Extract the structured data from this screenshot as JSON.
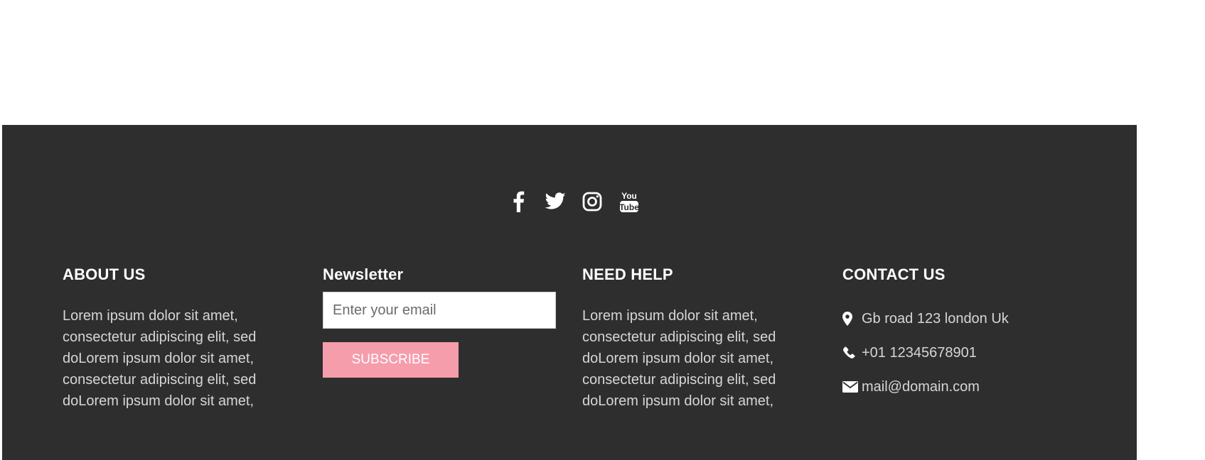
{
  "footer": {
    "social": [
      {
        "name": "facebook-icon"
      },
      {
        "name": "twitter-icon"
      },
      {
        "name": "instagram-icon"
      },
      {
        "name": "youtube-icon",
        "label_top": "You",
        "label_bottom": "Tube"
      }
    ],
    "about": {
      "heading": "ABOUT US",
      "text": "Lorem ipsum dolor sit amet, consectetur adipiscing elit, sed doLorem ipsum dolor sit amet, consectetur adipiscing elit, sed doLorem ipsum dolor sit amet,"
    },
    "newsletter": {
      "heading": "Newsletter",
      "email_placeholder": "Enter your email",
      "email_value": "",
      "subscribe_label": "SUBSCRIBE"
    },
    "help": {
      "heading": "NEED HELP",
      "text": "Lorem ipsum dolor sit amet, consectetur adipiscing elit, sed doLorem ipsum dolor sit amet, consectetur adipiscing elit, sed doLorem ipsum dolor sit amet,"
    },
    "contact": {
      "heading": "CONTACT US",
      "address": "Gb road 123 london Uk",
      "phone": "+01 12345678901",
      "email": "mail@domain.com"
    }
  },
  "colors": {
    "footer_bg": "#2e2e2e",
    "accent": "#f59dab",
    "heading": "#ffffff",
    "body_text": "#d6d6d6"
  }
}
